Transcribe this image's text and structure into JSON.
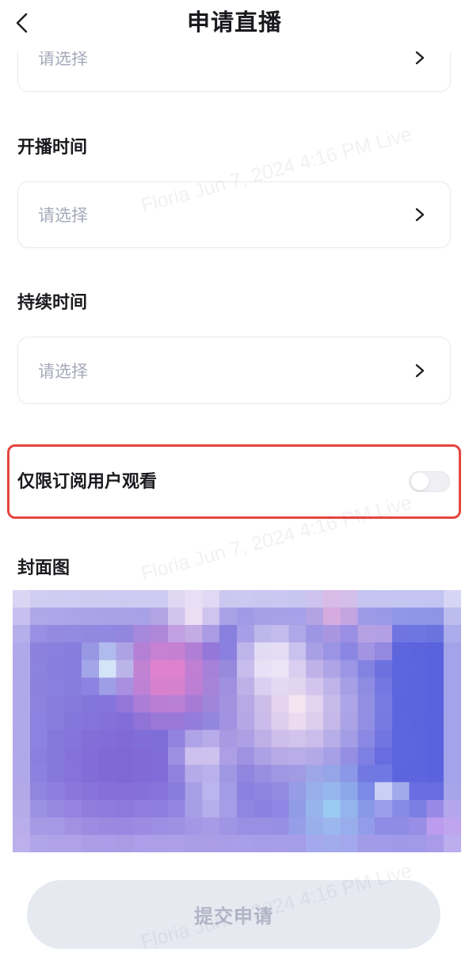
{
  "header": {
    "title": "申请直播"
  },
  "form": {
    "top_field": {
      "placeholder": "请选择"
    },
    "start_time": {
      "label": "开播时间",
      "placeholder": "请选择"
    },
    "duration": {
      "label": "持续时间",
      "placeholder": "请选择"
    },
    "subscriber_only": {
      "label": "仅限订阅用户观看",
      "enabled": false
    },
    "cover": {
      "label": "封面图"
    }
  },
  "submit": {
    "label": "提交申请",
    "disabled": true
  },
  "watermark": {
    "text": "Floria Jun 7, 2024 4:16 PM Live"
  },
  "icons": {
    "back": "chevron-left-icon",
    "field_arrow": "chevron-right-icon"
  },
  "colors": {
    "highlight_border": "#e5453f",
    "placeholder": "#a6a9ba",
    "button_bg": "#e7e9f1",
    "button_text": "#b2b6c6"
  }
}
